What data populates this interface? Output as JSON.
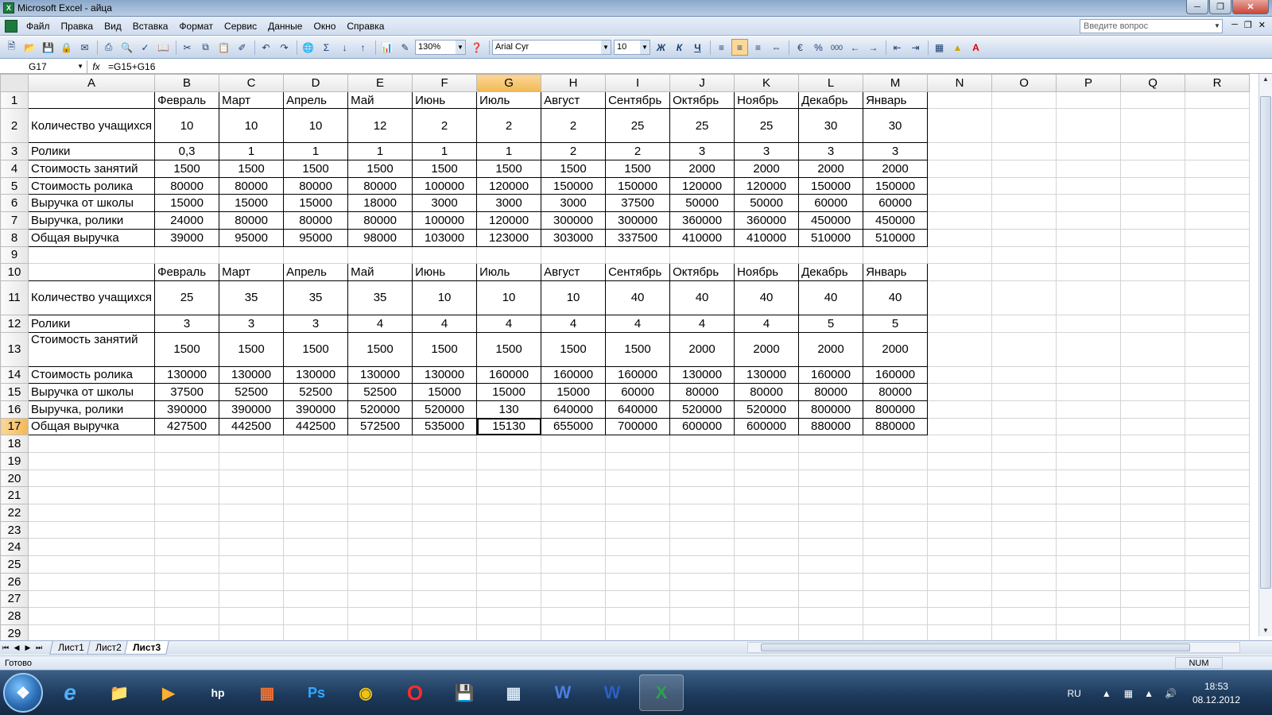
{
  "window": {
    "title": "Microsoft Excel - айца",
    "excel_icon_letter": "X"
  },
  "menu": {
    "items": [
      "Файл",
      "Правка",
      "Вид",
      "Вставка",
      "Формат",
      "Сервис",
      "Данные",
      "Окно",
      "Справка"
    ]
  },
  "help": {
    "placeholder": "Введите вопрос"
  },
  "toolbar": {
    "zoom": "130%",
    "font_name": "Arial Cyr",
    "font_size": "10",
    "bold_label": "Ж",
    "italic_label": "К",
    "underline_label": "Ч",
    "sum_label": "Σ",
    "percent_label": "%",
    "thousands_label": "000"
  },
  "formula_bar": {
    "name_box": "G17",
    "fx_label": "fx",
    "formula": "=G15+G16"
  },
  "columns": [
    "A",
    "B",
    "C",
    "D",
    "E",
    "F",
    "G",
    "H",
    "I",
    "J",
    "K",
    "L",
    "M",
    "N",
    "O",
    "P",
    "Q",
    "R"
  ],
  "active": {
    "column": "G",
    "row": "17"
  },
  "rows": {
    "r1": {
      "label": "",
      "values": [
        "Февраль",
        "Март",
        "Апрель",
        "Май",
        "Июнь",
        "Июль",
        "Август",
        "Сентябрь",
        "Октябрь",
        "Ноябрь",
        "Декабрь",
        "Январь"
      ]
    },
    "r2": {
      "label": "Количество учащихся",
      "values": [
        "10",
        "10",
        "10",
        "12",
        "2",
        "2",
        "2",
        "25",
        "25",
        "25",
        "30",
        "30"
      ]
    },
    "r3": {
      "label": "Ролики",
      "values": [
        "0,3",
        "1",
        "1",
        "1",
        "1",
        "1",
        "2",
        "2",
        "3",
        "3",
        "3",
        "3"
      ]
    },
    "r4": {
      "label": "Стоимость занятий",
      "values": [
        "1500",
        "1500",
        "1500",
        "1500",
        "1500",
        "1500",
        "1500",
        "1500",
        "2000",
        "2000",
        "2000",
        "2000"
      ]
    },
    "r5": {
      "label": "Стоимость ролика",
      "values": [
        "80000",
        "80000",
        "80000",
        "80000",
        "100000",
        "120000",
        "150000",
        "150000",
        "120000",
        "120000",
        "150000",
        "150000"
      ]
    },
    "r6": {
      "label": "Выручка от школы",
      "values": [
        "15000",
        "15000",
        "15000",
        "18000",
        "3000",
        "3000",
        "3000",
        "37500",
        "50000",
        "50000",
        "60000",
        "60000"
      ]
    },
    "r7": {
      "label": "Выручка, ролики",
      "values": [
        "24000",
        "80000",
        "80000",
        "80000",
        "100000",
        "120000",
        "300000",
        "300000",
        "360000",
        "360000",
        "450000",
        "450000"
      ]
    },
    "r8": {
      "label": "Общая выручка",
      "values": [
        "39000",
        "95000",
        "95000",
        "98000",
        "103000",
        "123000",
        "303000",
        "337500",
        "410000",
        "410000",
        "510000",
        "510000"
      ]
    },
    "r10": {
      "label": "",
      "values": [
        "Февраль",
        "Март",
        "Апрель",
        "Май",
        "Июнь",
        "Июль",
        "Август",
        "Сентябрь",
        "Октябрь",
        "Ноябрь",
        "Декабрь",
        "Январь"
      ]
    },
    "r11": {
      "label": "Количество учащихся",
      "values": [
        "25",
        "35",
        "35",
        "35",
        "10",
        "10",
        "10",
        "40",
        "40",
        "40",
        "40",
        "40"
      ]
    },
    "r12": {
      "label": "Ролики",
      "values": [
        "3",
        "3",
        "3",
        "4",
        "4",
        "4",
        "4",
        "4",
        "4",
        "4",
        "5",
        "5"
      ]
    },
    "r13": {
      "label": "Стоимость занятий",
      "values": [
        "1500",
        "1500",
        "1500",
        "1500",
        "1500",
        "1500",
        "1500",
        "1500",
        "2000",
        "2000",
        "2000",
        "2000"
      ]
    },
    "r14": {
      "label": "Стоимость ролика",
      "values": [
        "130000",
        "130000",
        "130000",
        "130000",
        "130000",
        "160000",
        "160000",
        "160000",
        "130000",
        "130000",
        "160000",
        "160000"
      ]
    },
    "r15": {
      "label": "Выручка от школы",
      "values": [
        "37500",
        "52500",
        "52500",
        "52500",
        "15000",
        "15000",
        "15000",
        "60000",
        "80000",
        "80000",
        "80000",
        "80000"
      ]
    },
    "r16": {
      "label": "Выручка, ролики",
      "values": [
        "390000",
        "390000",
        "390000",
        "520000",
        "520000",
        "130",
        "640000",
        "640000",
        "520000",
        "520000",
        "800000",
        "800000"
      ]
    },
    "r17": {
      "label": "Общая выручка",
      "values": [
        "427500",
        "442500",
        "442500",
        "572500",
        "535000",
        "15130",
        "655000",
        "700000",
        "600000",
        "600000",
        "880000",
        "880000"
      ]
    }
  },
  "sheets": [
    "Лист1",
    "Лист2",
    "Лист3"
  ],
  "active_sheet": "Лист3",
  "status": {
    "text": "Готово",
    "num": "NUM"
  },
  "taskbar": {
    "lang": "RU",
    "time": "18:53",
    "date": "08.12.2012"
  }
}
